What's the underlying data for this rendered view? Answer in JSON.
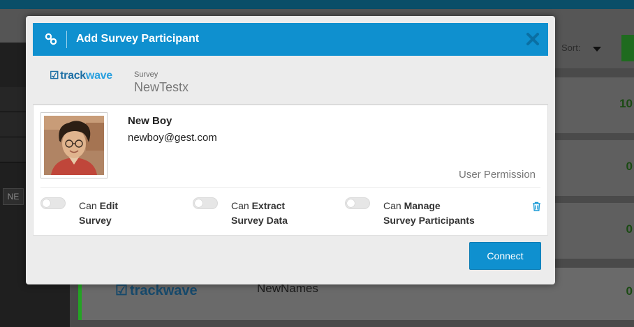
{
  "background": {
    "sidebar_button": "NE",
    "sort_label": "Sort:",
    "row_counts": [
      "10",
      "0",
      "0",
      "0"
    ],
    "last_row": {
      "brand": "trackwave",
      "name": "NewNames"
    }
  },
  "modal": {
    "title": "Add Survey Participant",
    "survey": {
      "brand_track": "track",
      "brand_wave": "wave",
      "label": "Survey",
      "name": "NewTestx"
    },
    "participant": {
      "name": "New Boy",
      "email": "newboy@gest.com"
    },
    "permissions": {
      "heading": "User Permission",
      "items": [
        {
          "prefix": "Can",
          "bold": "Edit",
          "rest": "Survey",
          "enabled": false
        },
        {
          "prefix": "Can",
          "bold": "Extract",
          "rest": "Survey Data",
          "enabled": false
        },
        {
          "prefix": "Can",
          "bold": "Manage",
          "rest": "Survey Participants",
          "enabled": false
        }
      ]
    },
    "connect_label": "Connect"
  },
  "colors": {
    "header_blue": "#0f90cf",
    "brand_dark": "#1d6fa5",
    "brand_light": "#2aa0df",
    "accent_green": "#24a324"
  }
}
